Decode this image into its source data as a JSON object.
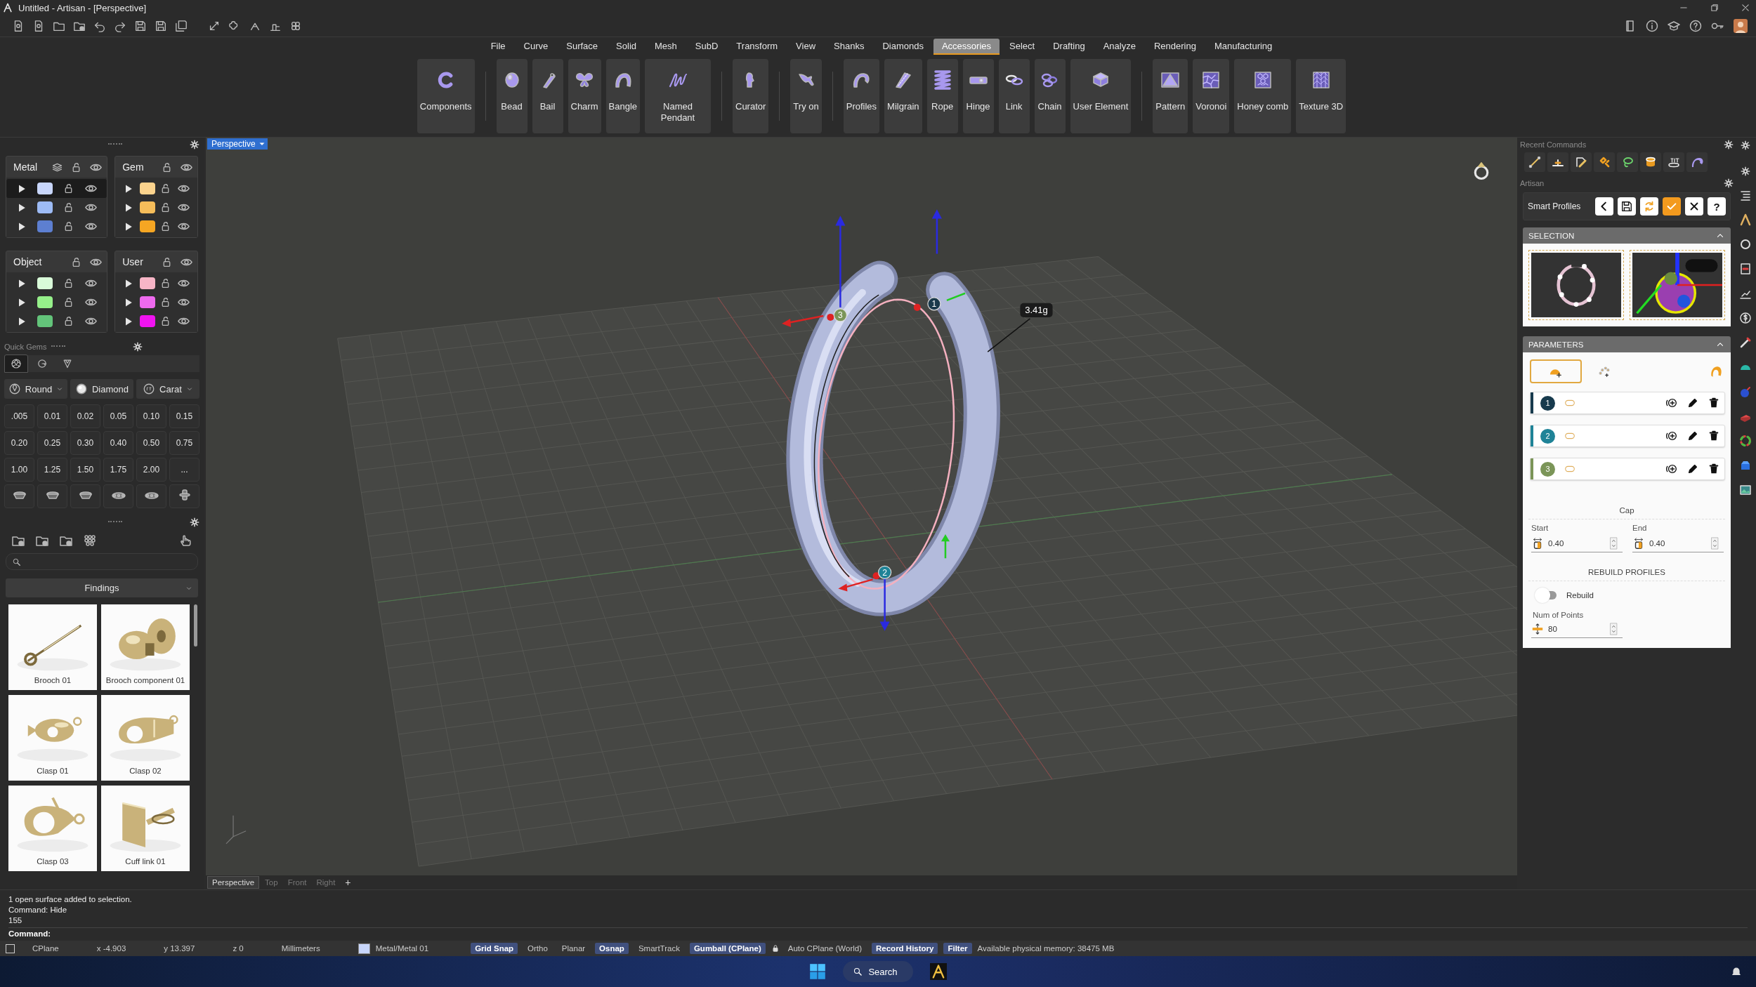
{
  "window": {
    "title": "Untitled - Artisan - [Perspective]"
  },
  "menu": [
    {
      "label": "File",
      "selected": false
    },
    {
      "label": "Curve",
      "selected": false
    },
    {
      "label": "Surface",
      "selected": false
    },
    {
      "label": "Solid",
      "selected": false
    },
    {
      "label": "Mesh",
      "selected": false
    },
    {
      "label": "SubD",
      "selected": false
    },
    {
      "label": "Transform",
      "selected": false
    },
    {
      "label": "View",
      "selected": false
    },
    {
      "label": "Shanks",
      "selected": false
    },
    {
      "label": "Diamonds",
      "selected": false
    },
    {
      "label": "Accessories",
      "selected": true
    },
    {
      "label": "Select",
      "selected": false
    },
    {
      "label": "Drafting",
      "selected": false
    },
    {
      "label": "Analyze",
      "selected": false
    },
    {
      "label": "Rendering",
      "selected": false
    },
    {
      "label": "Manufacturing",
      "selected": false
    }
  ],
  "ribbon": [
    {
      "buttons": [
        "Components"
      ]
    },
    {
      "buttons": [
        "Bead",
        "Bail",
        "Charm",
        "Bangle",
        "Named Pendant"
      ]
    },
    {
      "buttons": [
        "Curator"
      ]
    },
    {
      "buttons": [
        "Try on"
      ]
    },
    {
      "buttons": [
        "Profiles",
        "Milgrain",
        "Rope",
        "Hinge",
        "Link",
        "Chain",
        "User Element"
      ]
    },
    {
      "buttons": [
        "Pattern",
        "Voronoi",
        "Honey comb",
        "Texture 3D"
      ]
    }
  ],
  "layer_groups": [
    {
      "name": "Metal",
      "layers": [
        {
          "color": "#c8d6fb",
          "selected": true
        },
        {
          "color": "#9dbbf5",
          "selected": false
        },
        {
          "color": "#5d7fd1",
          "selected": false
        }
      ]
    },
    {
      "name": "Gem",
      "layers": [
        {
          "color": "#fbd38d",
          "selected": false
        },
        {
          "color": "#f5bd5a",
          "selected": false
        },
        {
          "color": "#f5a623",
          "selected": false
        }
      ]
    },
    {
      "name": "Object",
      "layers": [
        {
          "color": "#d9fbd9",
          "selected": false
        },
        {
          "color": "#96f08a",
          "selected": false
        },
        {
          "color": "#63c47a",
          "selected": false
        }
      ]
    },
    {
      "name": "User",
      "layers": [
        {
          "color": "#f7b5c6",
          "selected": false
        },
        {
          "color": "#ee6aee",
          "selected": false
        },
        {
          "color": "#f013f0",
          "selected": false
        }
      ]
    }
  ],
  "quick_gems": {
    "title": "Quick Gems",
    "tabs": [
      {
        "selected": true
      },
      {
        "selected": false
      },
      {
        "selected": false
      }
    ],
    "selectors": [
      {
        "label": "Round",
        "kind": "dropdown"
      },
      {
        "label": "Diamond",
        "kind": "button"
      },
      {
        "label": "Carat",
        "kind": "dropdown"
      }
    ],
    "sizes": [
      ".005",
      "0.01",
      "0.02",
      "0.05",
      "0.10",
      "0.15",
      "0.20",
      "0.25",
      "0.30",
      "0.40",
      "0.50",
      "0.75",
      "1.00",
      "1.25",
      "1.50",
      "1.75",
      "2.00",
      "..."
    ]
  },
  "library": {
    "category": "Findings",
    "items": [
      {
        "caption": "Brooch 01"
      },
      {
        "caption": "Brooch component 01"
      },
      {
        "caption": "Clasp 01"
      },
      {
        "caption": "Clasp 02"
      },
      {
        "caption": "Clasp 03"
      },
      {
        "caption": "Cuff link 01"
      }
    ]
  },
  "viewport": {
    "view": "Perspective",
    "weight": "3.41g",
    "markers": [
      "1",
      "2",
      "3"
    ],
    "view_tabs": [
      {
        "label": "Perspective",
        "selected": true
      },
      {
        "label": "Top",
        "selected": false
      },
      {
        "label": "Front",
        "selected": false
      },
      {
        "label": "Right",
        "selected": false
      }
    ],
    "add_tab": "+"
  },
  "recent_commands": {
    "title": "Recent Commands"
  },
  "artisan": {
    "title": "Artisan",
    "tool": "Smart Profiles",
    "buttons": [
      {
        "kind": "back"
      },
      {
        "kind": "save"
      },
      {
        "kind": "refresh"
      },
      {
        "kind": "apply"
      },
      {
        "kind": "close"
      },
      {
        "kind": "help",
        "label": "?"
      }
    ],
    "selection": {
      "title": "SELECTION",
      "expanded": true
    },
    "parameters": {
      "title": "PARAMETERS",
      "expanded": true,
      "modes": [
        {
          "selected": true
        },
        {
          "selected": false
        }
      ],
      "profiles": [
        {
          "number": "1",
          "color": "#173a4d"
        },
        {
          "number": "2",
          "color": "#1f8397"
        },
        {
          "number": "3",
          "color": "#7b9558"
        }
      ],
      "cap": {
        "title": "Cap",
        "start_label": "Start",
        "start_value": "0.40",
        "end_label": "End",
        "end_value": "0.40"
      },
      "rebuild": {
        "title": "REBUILD PROFILES",
        "label": "Rebuild",
        "on": false,
        "points_label": "Num of Points",
        "points_value": "80"
      }
    }
  },
  "command_line": {
    "history": [
      "1 open surface added to selection.",
      "Command: Hide",
      "155"
    ],
    "prompt": "Command:"
  },
  "status_bar": [
    {
      "kind": "text",
      "label": "CPlane"
    },
    {
      "kind": "text",
      "label": "x -4.903"
    },
    {
      "kind": "text",
      "label": "y 13.397"
    },
    {
      "kind": "text",
      "label": "z 0"
    },
    {
      "kind": "text",
      "label": "Millimeters"
    },
    {
      "kind": "layer",
      "label": "Metal/Metal 01",
      "color": "#c8d6fb"
    },
    {
      "kind": "toggle",
      "label": "Grid Snap",
      "on": true
    },
    {
      "kind": "toggle",
      "label": "Ortho",
      "on": false
    },
    {
      "kind": "toggle",
      "label": "Planar",
      "on": false
    },
    {
      "kind": "toggle",
      "label": "Osnap",
      "on": true
    },
    {
      "kind": "toggle",
      "label": "SmartTrack",
      "on": false
    },
    {
      "kind": "toggle",
      "label": "Gumball (CPlane)",
      "on": true
    },
    {
      "kind": "locked",
      "label": "Auto CPlane (World)"
    },
    {
      "kind": "toggle",
      "label": "Record History",
      "on": true
    },
    {
      "kind": "toggle",
      "label": "Filter",
      "on": true
    },
    {
      "kind": "text",
      "label": "Available physical memory: 38475 MB"
    }
  ],
  "taskbar": {
    "search": "Search"
  }
}
